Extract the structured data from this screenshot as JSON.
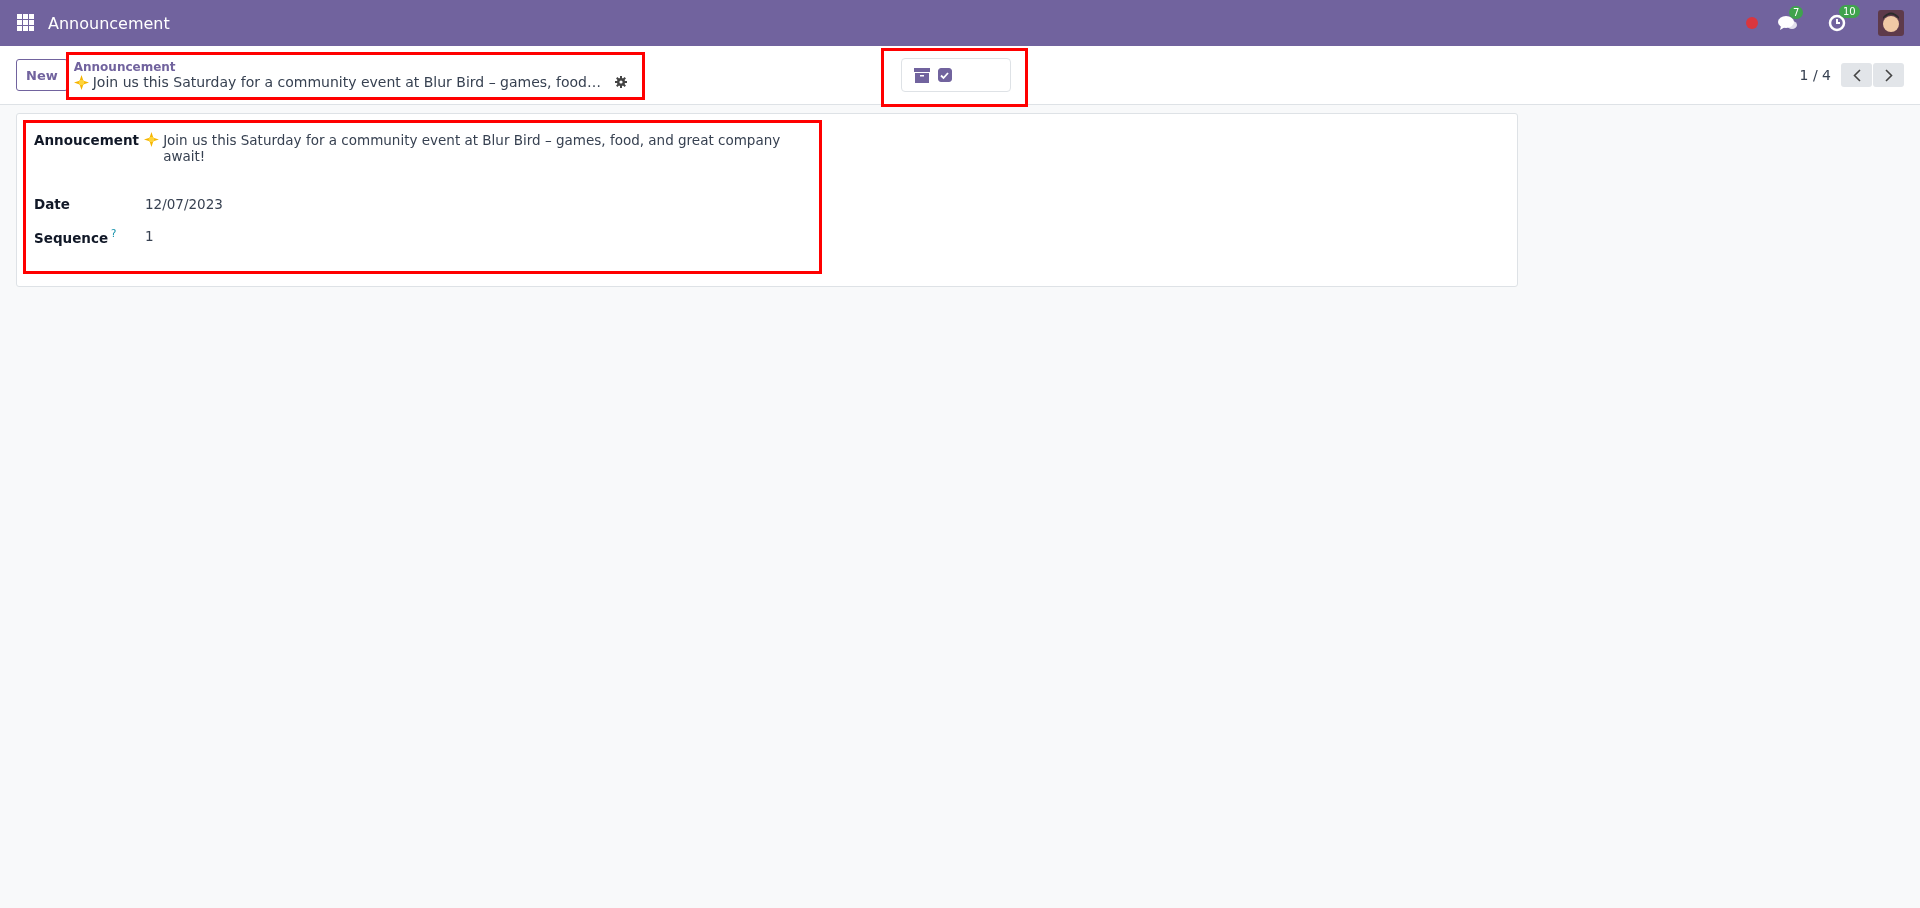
{
  "navbar": {
    "app_title": "Announcement",
    "notifications": [
      {
        "kind": "chat",
        "count": "7"
      },
      {
        "kind": "activity",
        "count": "10"
      }
    ]
  },
  "control_panel": {
    "new_button": "New",
    "breadcrumb": "Announcement",
    "record_title": "Join us this Saturday for a community event at Blur Bird – games, food…",
    "archive_checkbox": {
      "checked": true
    },
    "pager": "1 / 4"
  },
  "form": {
    "fields": [
      {
        "label": "Annoucement",
        "value": "Join us this Saturday for a community event at Blur Bird – games, food, and great company await!",
        "kind": "emoji"
      },
      {
        "label": "Date",
        "value": "12/07/2023",
        "kind": "plain"
      },
      {
        "label": "Sequence",
        "help": "?",
        "value": "1",
        "kind": "plain"
      }
    ]
  }
}
